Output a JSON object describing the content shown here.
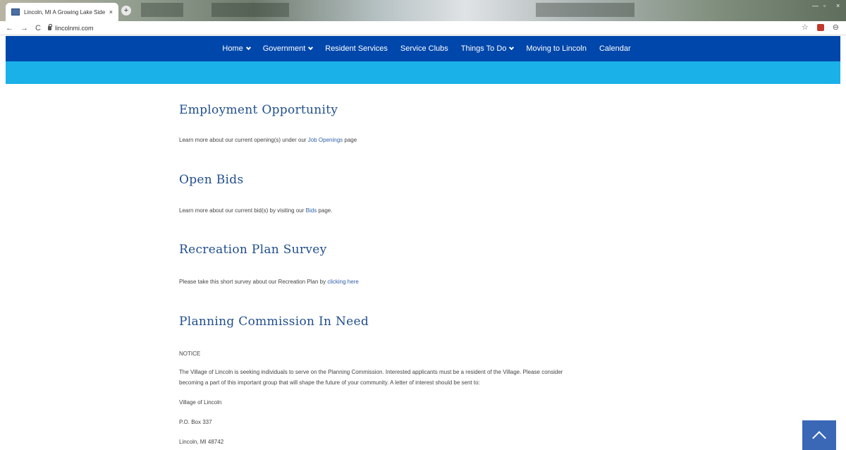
{
  "browser": {
    "tab_title": "Lincoln, MI A Growing Lake Side",
    "tab_close": "×",
    "new_tab": "+",
    "url": "lincolnmi.com",
    "back": "←",
    "forward": "→",
    "reload": "C",
    "star": "☆",
    "profile": "⊖"
  },
  "nav": {
    "items": [
      {
        "label": "Home",
        "dropdown": true
      },
      {
        "label": "Government",
        "dropdown": true
      },
      {
        "label": "Resident Services",
        "dropdown": false
      },
      {
        "label": "Service Clubs",
        "dropdown": false
      },
      {
        "label": "Things To Do",
        "dropdown": true
      },
      {
        "label": "Moving to Lincoln",
        "dropdown": false
      },
      {
        "label": "Calendar",
        "dropdown": false
      }
    ]
  },
  "sections": {
    "employment": {
      "title": "Employment Opportunity",
      "text_before": "Learn more about our current opening(s) under our ",
      "link": "Job Openings",
      "text_after": " page"
    },
    "bids": {
      "title": "Open Bids",
      "text_before": "Learn more about our current bid(s) by visiting our ",
      "link": "Bids",
      "text_after": " page."
    },
    "recreation": {
      "title": "Recreation Plan Survey",
      "text_before": "Please take this short survey about our Recreation Plan by ",
      "link": "clicking here"
    },
    "planning": {
      "title": "Planning Commission In Need",
      "notice": "NOTICE",
      "body_line1": "The Village of Lincoln is seeking individuals to serve on the Planning Commission. Interested applicants must be a resident of the Village. Please consider",
      "body_line2": "becoming a part of this important group that will shape the future of your community. A letter of interest should be sent to:",
      "address_name": "Village of Lincoln",
      "address_po": "P.O. Box 337",
      "address_city": "Lincoln, MI 48742"
    }
  },
  "colors": {
    "nav_bg": "#0047ab",
    "subbar_bg": "#1ab0e8",
    "heading": "#1f4e8c",
    "link": "#2e5fa8",
    "scroll_top_bg": "#3a68b7"
  }
}
